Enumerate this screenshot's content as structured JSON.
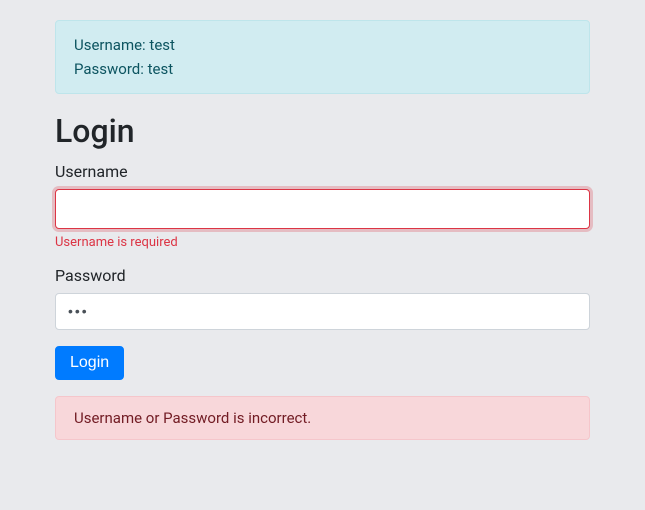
{
  "info": {
    "line1": "Username: test",
    "line2": "Password: test"
  },
  "heading": "Login",
  "form": {
    "username": {
      "label": "Username",
      "value": "",
      "error": "Username is required"
    },
    "password": {
      "label": "Password",
      "value": "•••"
    },
    "submit_label": "Login"
  },
  "error_message": "Username or Password is incorrect."
}
